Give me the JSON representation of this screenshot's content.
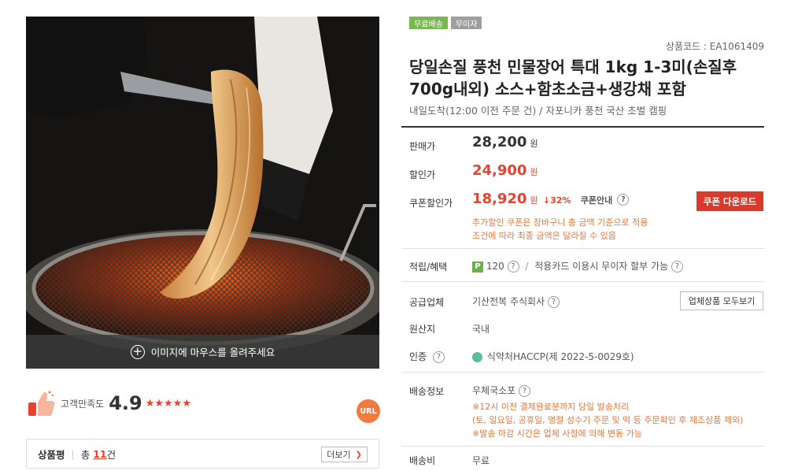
{
  "image": {
    "hover_hint": "이미지에 마우스를 올려주세요"
  },
  "rating": {
    "label": "고객만족도",
    "score": "4.9",
    "stars": "★★★★★"
  },
  "url_badge": "URL",
  "reviews": {
    "title": "상품평",
    "count_prefix": "총",
    "count_number": "11",
    "count_suffix": "건",
    "more_label": "더보기"
  },
  "badges": [
    "무료배송",
    "무이자"
  ],
  "product": {
    "code": "상품코드 : EA1061409",
    "title": "당일손질 풍천 민물장어 특대 1kg 1-3미(손질후 700g내외) 소스+함초소금+생강채 포함",
    "delivery_subtitle": "내일도착(12:00 이전 주문 건) / 자포니카 풍천 국산 초벌 캠핑"
  },
  "prices": {
    "sale_label": "판매가",
    "sale_value": "28,200",
    "discount_label": "할인가",
    "discount_value": "24,900",
    "coupon_label": "쿠폰할인가",
    "coupon_value": "18,920",
    "coupon_rate": "32%",
    "coupon_guide": "쿠폰안내",
    "currency": "원",
    "coupon_download": "쿠폰 다운로드",
    "coupon_note_1": "추가할인 쿠폰은 장바구니 총 금액 기준으로 적용",
    "coupon_note_2": "조건에 따라 최종 금액은 달라질 수 있음"
  },
  "benefits": {
    "label": "적립/혜택",
    "points": "120",
    "card_text": "적용카드 이용시 무이자 할부 가능"
  },
  "supplier": {
    "label": "공급업체",
    "name": "기산전복 주식회사",
    "button": "업체상품 모두보기"
  },
  "origin": {
    "label": "원산지",
    "value": "국내"
  },
  "certification": {
    "label": "인증",
    "value": "식약처HACCP(제 2022-5-0029호)"
  },
  "shipping": {
    "label": "배송정보",
    "carrier": "우체국소포",
    "note_1": "※12시 이전 결제완료분까지 당일 발송처리",
    "note_2": "(토, 일요일, 공휴일, 명절 성수기 주문 및 떡 등 주문확인 후 제조상품 제외)",
    "note_3": "※발송 마감 시간은 업체 사정에 의해 변동 가능",
    "fee_label": "배송비",
    "fee_value": "무료"
  },
  "colors": {
    "accent_red": "#e8412e",
    "coupon_button": "#d93a2b",
    "note_orange": "#e0793f",
    "badge_green": "#79b851"
  }
}
